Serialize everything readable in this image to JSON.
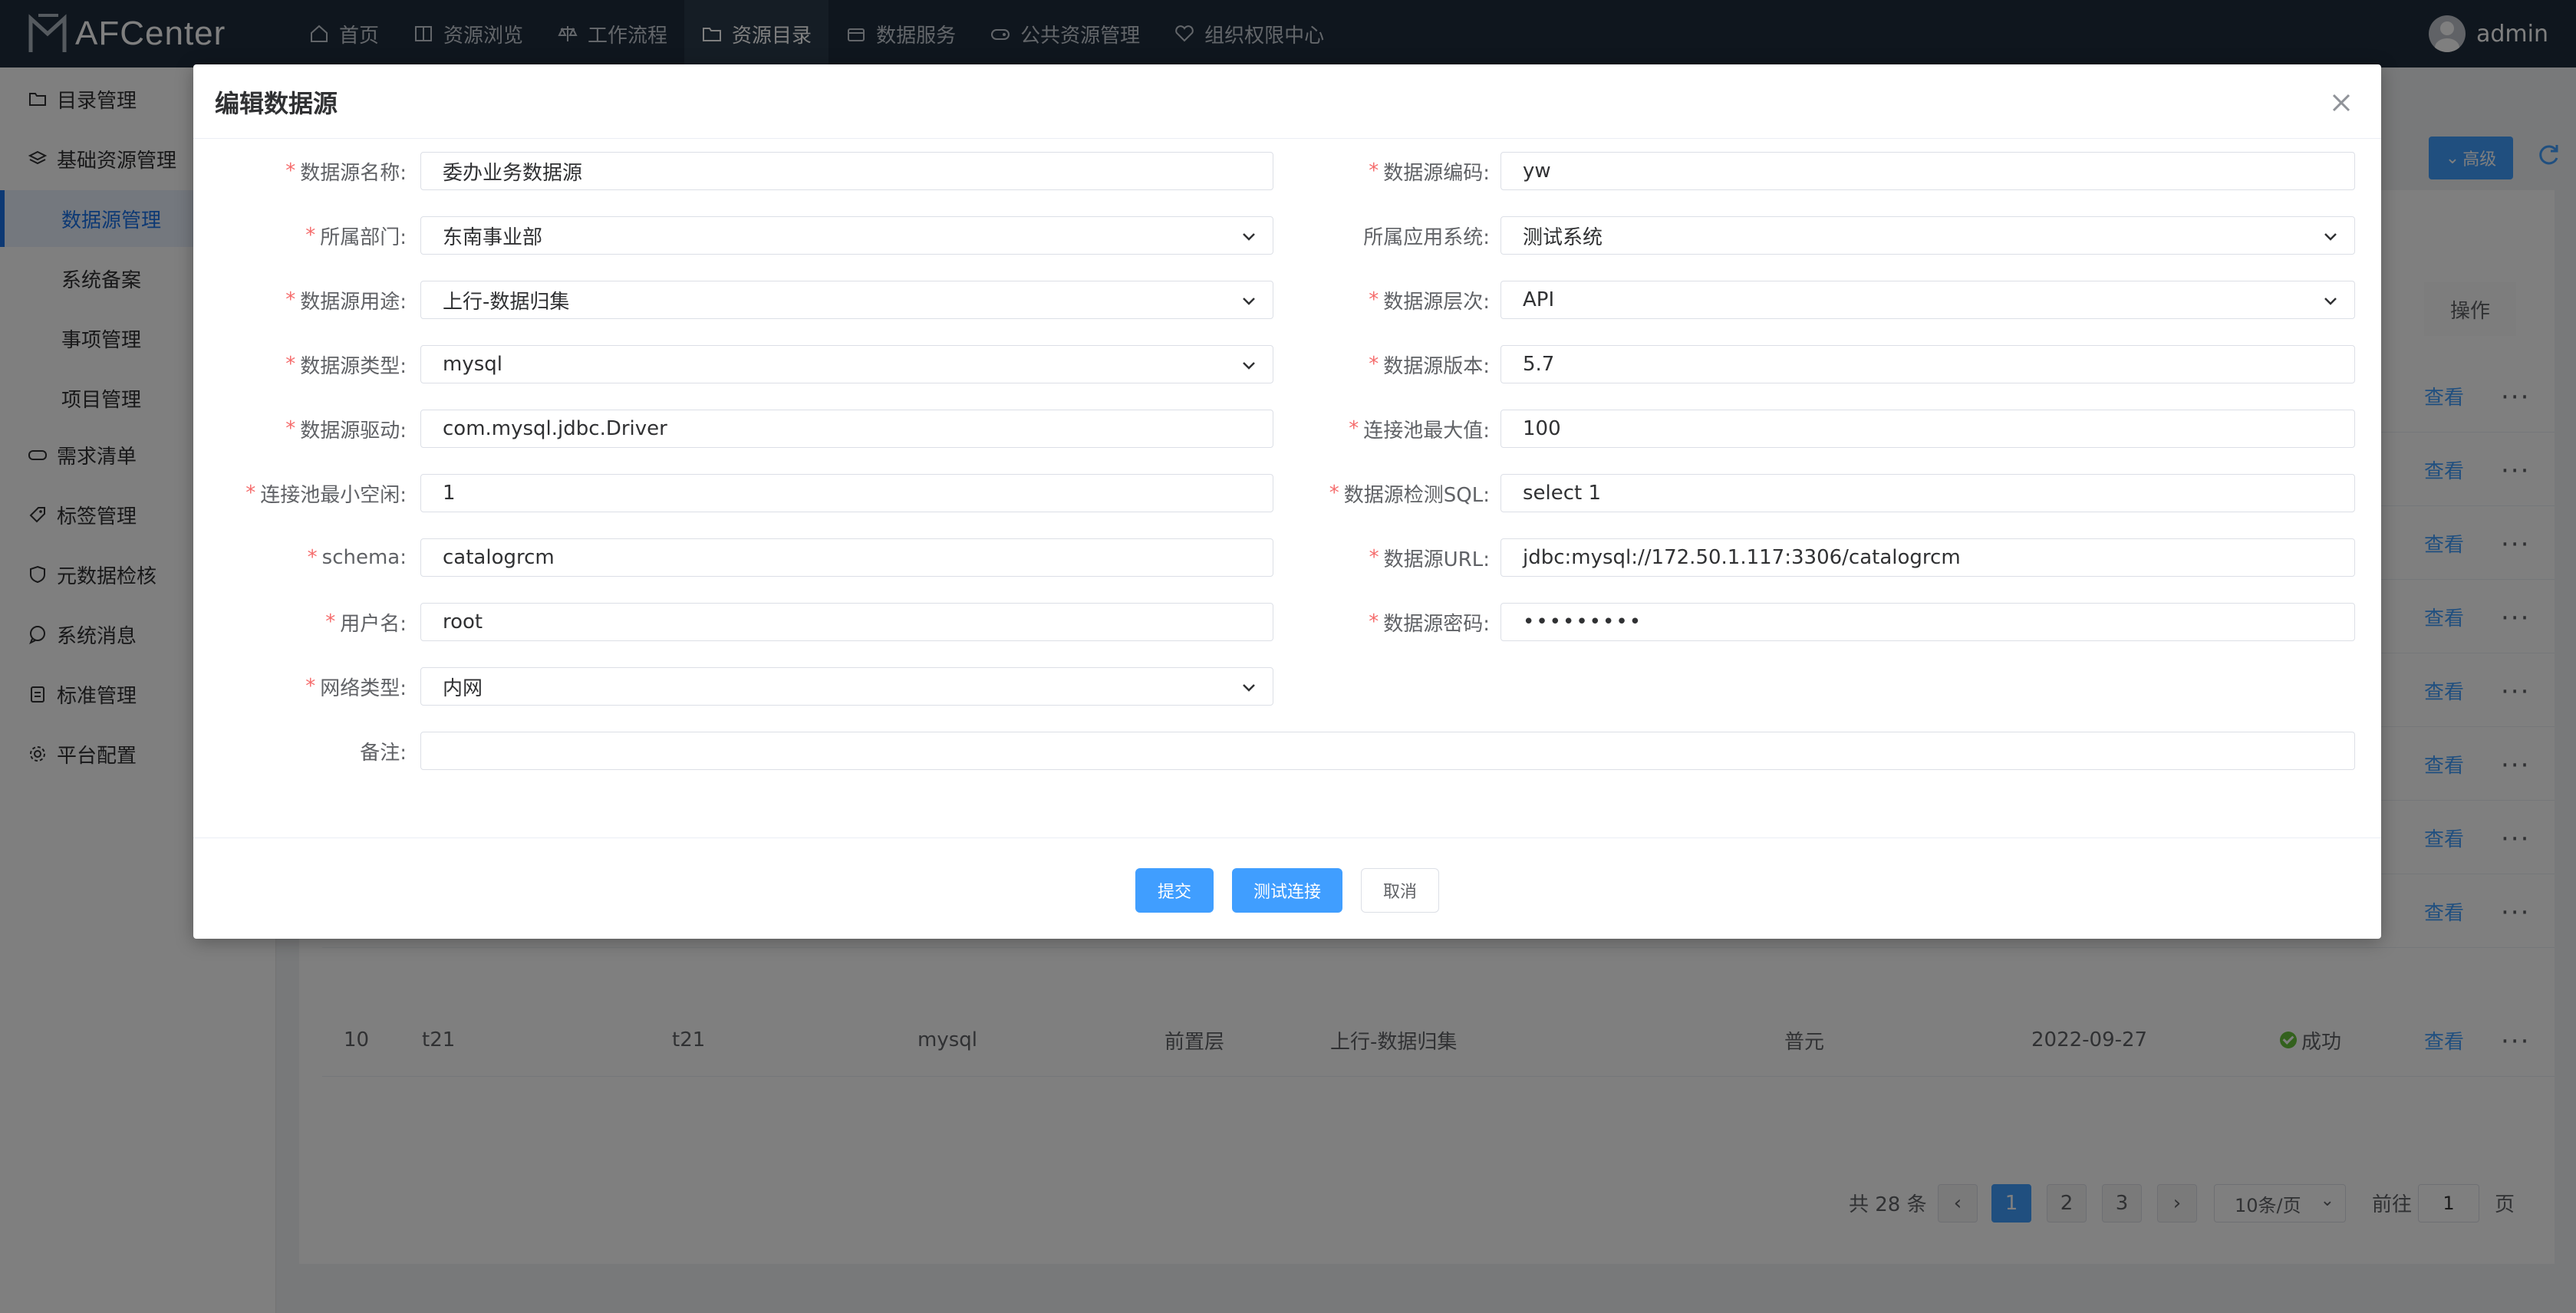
{
  "app": {
    "title": "AFCenter",
    "user": "admin"
  },
  "nav": [
    {
      "label": "首页",
      "icon": "home-icon"
    },
    {
      "label": "资源浏览",
      "icon": "book-icon"
    },
    {
      "label": "工作流程",
      "icon": "scale-icon"
    },
    {
      "label": "资源目录",
      "icon": "folder-icon"
    },
    {
      "label": "数据服务",
      "icon": "box-icon"
    },
    {
      "label": "公共资源管理",
      "icon": "gamepad-icon"
    },
    {
      "label": "组织权限中心",
      "icon": "heart-icon"
    }
  ],
  "sidebar": [
    {
      "label": "目录管理",
      "icon": "folder-icon"
    },
    {
      "label": "基础资源管理",
      "icon": "layers-icon"
    },
    {
      "label": "数据源管理"
    },
    {
      "label": "系统备案"
    },
    {
      "label": "事项管理"
    },
    {
      "label": "项目管理"
    },
    {
      "label": "需求清单",
      "icon": "gamepad-icon"
    },
    {
      "label": "标签管理",
      "icon": "tag-icon"
    },
    {
      "label": "元数据检核",
      "icon": "shield-icon"
    },
    {
      "label": "系统消息",
      "icon": "chat-icon"
    },
    {
      "label": "标准管理",
      "icon": "clipboard-icon"
    },
    {
      "label": "平台配置",
      "icon": "gear-icon"
    }
  ],
  "toolbar": {
    "advanced_label": "高级"
  },
  "table": {
    "op_header": "操作",
    "view_label": "查看",
    "last_row": {
      "index": "10",
      "name": "t21",
      "code": "t21",
      "type": "mysql",
      "layer": "前置层",
      "usage": "上行-数据归集",
      "owner": "普元",
      "date": "2022-09-27",
      "status": "成功"
    }
  },
  "pagination": {
    "total": "共 28 条",
    "pages": [
      "1",
      "2",
      "3"
    ],
    "active_page": "1",
    "prev": "‹",
    "next": "›",
    "page_size": "10条/页",
    "goto_label": "前往",
    "goto_value": "1",
    "page_suffix": "页"
  },
  "dialog": {
    "title": "编辑数据源",
    "fields": {
      "ds_name": {
        "label": "数据源名称:",
        "value": "委办业务数据源"
      },
      "ds_code": {
        "label": "数据源编码:",
        "value": "yw"
      },
      "dept": {
        "label": "所属部门:",
        "value": "东南事业部"
      },
      "app_system": {
        "label": "所属应用系统:",
        "value": "测试系统"
      },
      "purpose": {
        "label": "数据源用途:",
        "value": "上行-数据归集"
      },
      "layer": {
        "label": "数据源层次:",
        "value": "API"
      },
      "ds_type": {
        "label": "数据源类型:",
        "value": "mysql"
      },
      "ds_version": {
        "label": "数据源版本:",
        "value": "5.7"
      },
      "driver": {
        "label": "数据源驱动:",
        "value": "com.mysql.jdbc.Driver"
      },
      "pool_max": {
        "label": "连接池最大值:",
        "value": "100"
      },
      "pool_min_idle": {
        "label": "连接池最小空闲:",
        "value": "1"
      },
      "check_sql": {
        "label": "数据源检测SQL:",
        "value": "select 1"
      },
      "schema": {
        "label": "schema:",
        "value": "catalogrcm"
      },
      "url": {
        "label": "数据源URL:",
        "value": "jdbc:mysql://172.50.1.117:3306/catalogrcm"
      },
      "username": {
        "label": "用户名:",
        "value": "root"
      },
      "password": {
        "label": "数据源密码:",
        "value": "•••••••••"
      },
      "network": {
        "label": "网络类型:",
        "value": "内网"
      },
      "remark": {
        "label": "备注:",
        "value": ""
      }
    },
    "buttons": {
      "submit": "提交",
      "test": "测试连接",
      "cancel": "取消"
    }
  },
  "colors": {
    "primary": "#409eff",
    "topbar": "#1f2d3d",
    "required": "#f56c6c",
    "success": "#67c23a"
  }
}
